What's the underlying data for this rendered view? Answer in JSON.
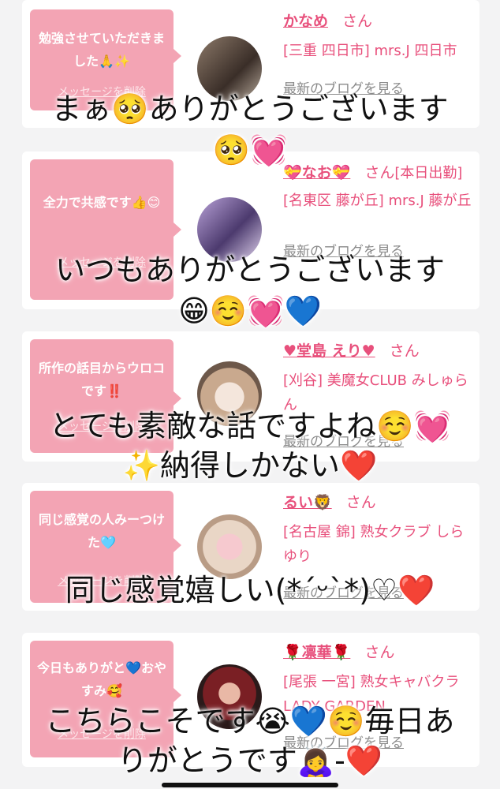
{
  "delete_label": "メッセージを削除",
  "blog_label": "最新のブログを見る",
  "san_label": "さん",
  "items": [
    {
      "message": "勉強させていただきました🙏✨",
      "name": "かなめ",
      "name_suffix": "",
      "meta": "[三重 四日市] mrs.J 四日市",
      "overlay": [
        "まぁ🥺ありがとうございます",
        "🥺💓"
      ]
    },
    {
      "message": "全力で共感です👍😊",
      "name": "💝なお💝",
      "name_suffix": "[本日出勤]",
      "meta": "[名東区 藤が丘] mrs.J 藤が丘",
      "overlay": [
        "いつもありがとうございます",
        "😁☺️💓💙"
      ]
    },
    {
      "message": "所作の話目からウロコです‼️",
      "name": "♥堂島 えり♥",
      "name_suffix": "",
      "meta": "[刈谷] 美魔女CLUB みしゅらん",
      "overlay": [
        "とても素敵な話ですよね☺️💓",
        "✨納得しかない❤️"
      ]
    },
    {
      "message": "同じ感覚の人みーつけた🩵",
      "name": "るい🦁",
      "name_suffix": "",
      "meta": "[名古屋 錦] 熟女クラブ しらゆり",
      "overlay": [
        "同じ感覚嬉しい(*ˊᵕˋ*)♡❤️"
      ]
    },
    {
      "message": "今日もありがと💙おやすみ🥰",
      "name": "🌹凛華🌹",
      "name_suffix": "",
      "meta": "[尾張 一宮] 熟女キャバクラ LADY GARDEN",
      "overlay": [
        "こちらこそです😭💙☺️毎日あ",
        "りがとうです🙇‍♀️-❤️"
      ]
    }
  ]
}
